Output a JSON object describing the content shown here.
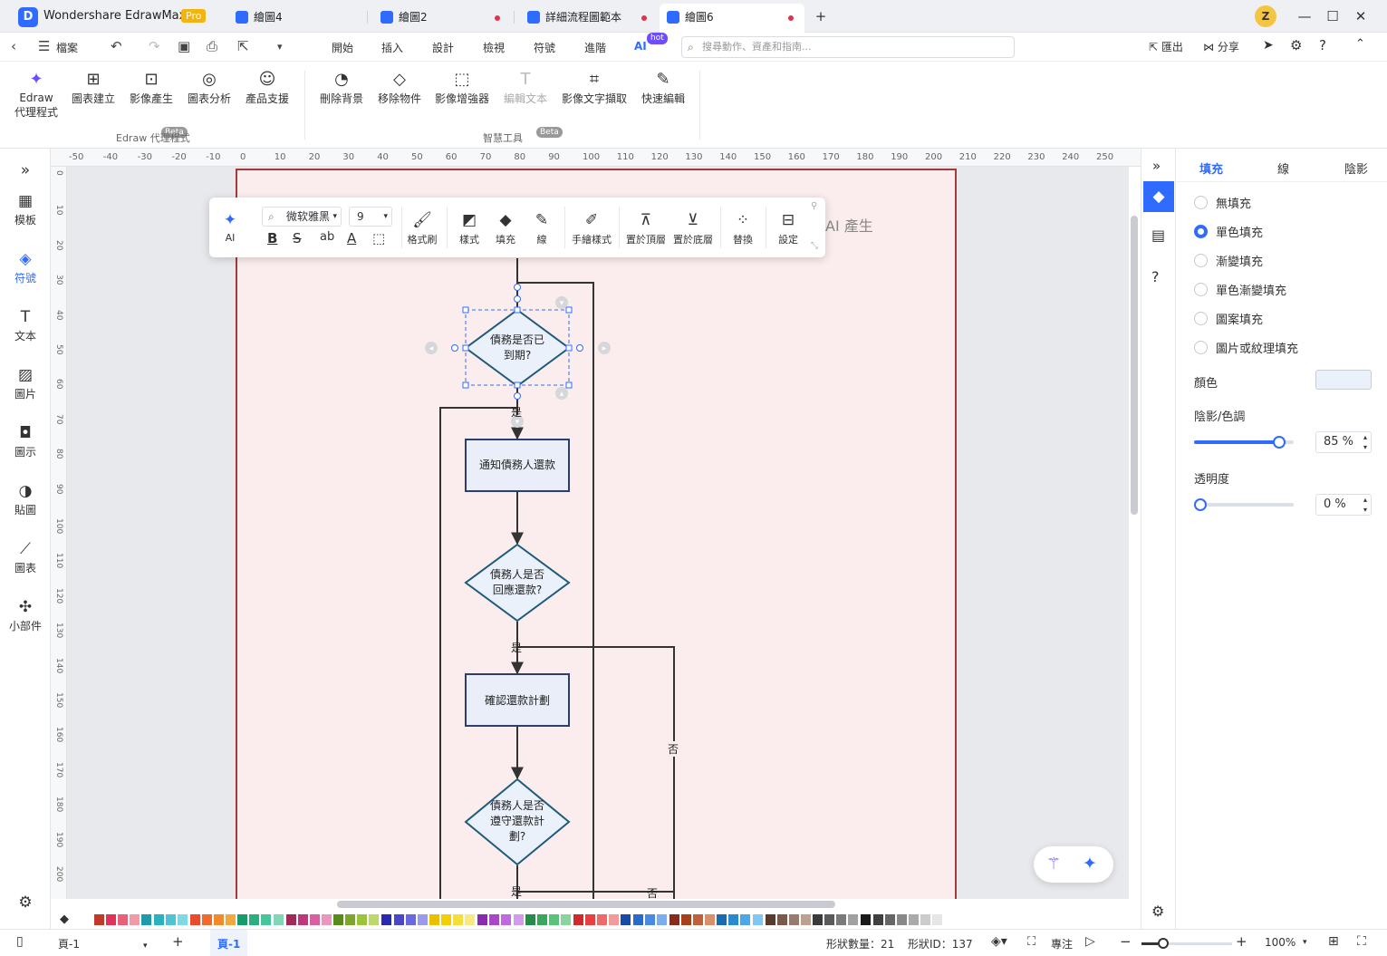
{
  "titlebar": {
    "app_name": "Wondershare EdrawMax",
    "pro_badge": "Pro",
    "tabs": [
      {
        "label": "繪圖4",
        "unsaved": false
      },
      {
        "label": "繪圖2",
        "unsaved": true
      },
      {
        "label": "詳細流程圖範本",
        "unsaved": true
      },
      {
        "label": "繪圖6",
        "unsaved": true,
        "active": true
      }
    ],
    "new_tab": "+",
    "avatar_letter": "Z"
  },
  "menubar": {
    "file_label": "檔案",
    "menus": [
      "開始",
      "插入",
      "設計",
      "檢視",
      "符號",
      "進階",
      "AI"
    ],
    "active_menu": "AI",
    "hot_badge": "hot",
    "search_placeholder": "搜尋動作、資產和指南...",
    "export_label": "匯出",
    "share_label": "分享"
  },
  "ribbon": {
    "agent_group": {
      "label": "Edraw 代理程式",
      "items": [
        {
          "label_line1": "Edraw",
          "label_line2": "代理程式",
          "icon": "sparkle-icon"
        },
        {
          "label": "圖表建立",
          "icon": "chart-build-icon"
        },
        {
          "label": "影像產生",
          "icon": "image-gen-icon",
          "badge": "Beta"
        },
        {
          "label": "圖表分析",
          "icon": "chart-analysis-icon"
        },
        {
          "label": "產品支援",
          "icon": "support-icon"
        }
      ]
    },
    "smart_group": {
      "label": "智慧工具",
      "items": [
        {
          "label": "刪除背景",
          "icon": "remove-bg-icon"
        },
        {
          "label": "移除物件",
          "icon": "eraser-icon"
        },
        {
          "label": "影像增強器",
          "icon": "enhance-icon"
        },
        {
          "label": "編輯文本",
          "icon": "edit-text-icon",
          "badge": "Beta",
          "disabled": true
        },
        {
          "label": "影像文字擷取",
          "icon": "ocr-icon"
        },
        {
          "label": "快速編輯",
          "icon": "quick-edit-icon"
        }
      ]
    }
  },
  "leftbar": {
    "items": [
      {
        "label": "模板",
        "icon": "template-icon"
      },
      {
        "label": "符號",
        "icon": "symbol-icon",
        "active": true
      },
      {
        "label": "文本",
        "icon": "text-icon"
      },
      {
        "label": "圖片",
        "icon": "image-icon"
      },
      {
        "label": "圖示",
        "icon": "icon-icon"
      },
      {
        "label": "貼圖",
        "icon": "sticker-icon"
      },
      {
        "label": "圖表",
        "icon": "chart-icon"
      },
      {
        "label": "小部件",
        "icon": "widget-icon"
      }
    ]
  },
  "ruler": {
    "h_labels": [
      "-50",
      "-40",
      "-30",
      "-20",
      "-10",
      "0",
      "10",
      "20",
      "30",
      "40",
      "50",
      "60",
      "70",
      "80",
      "90",
      "100",
      "110",
      "120",
      "130",
      "140",
      "150",
      "160",
      "170",
      "180",
      "190",
      "200",
      "210",
      "220",
      "230",
      "240",
      "250"
    ],
    "v_labels": [
      "0",
      "10",
      "20",
      "30",
      "40",
      "50",
      "60",
      "70",
      "80",
      "90",
      "100",
      "110",
      "120",
      "130",
      "140",
      "150",
      "160",
      "170",
      "180",
      "190",
      "200"
    ]
  },
  "floating_toolbar": {
    "ai_label": "AI",
    "font_name": "微软雅黑",
    "font_size": "9",
    "format_painter": "格式刷",
    "style": "樣式",
    "fill": "填充",
    "line": "線",
    "hand_drawn": "手繪樣式",
    "bring_front": "置於頂層",
    "send_back": "置於底層",
    "replace": "替換",
    "settings": "設定"
  },
  "canvas": {
    "ai_generated_label": "AI 產生",
    "flowchart": {
      "nodes": [
        {
          "text": "債務是否已\n到期?"
        },
        {
          "text": "通知債務人還款"
        },
        {
          "text": "債務人是否\n回應還款?"
        },
        {
          "text": "確認還款計劃"
        },
        {
          "text": "債務人是否\n遵守還款計\n劃?"
        }
      ],
      "labels": {
        "yes1": "是",
        "yes2": "是",
        "no1": "否",
        "yes3": "是",
        "no2": "否"
      }
    }
  },
  "rightpanel": {
    "tabs": [
      "填充",
      "線",
      "陰影"
    ],
    "active_tab": "填充",
    "fill_options": [
      {
        "label": "無填充",
        "selected": false
      },
      {
        "label": "單色填充",
        "selected": true
      },
      {
        "label": "漸變填充",
        "selected": false
      },
      {
        "label": "單色漸變填充",
        "selected": false
      },
      {
        "label": "圖案填充",
        "selected": false
      },
      {
        "label": "圖片或紋理填充",
        "selected": false
      }
    ],
    "color_label": "顏色",
    "color_value": "#eaf1fb",
    "shade_label": "陰影/色調",
    "shade_value": "85 %",
    "shade_fraction": 0.85,
    "transparency_label": "透明度",
    "transparency_value": "0 %",
    "transparency_fraction": 0
  },
  "palette": {
    "colors": [
      "#c0392b",
      "#e0325a",
      "#e8607a",
      "#f29aa8",
      "#1f9aa8",
      "#2bb0c0",
      "#4cc4d4",
      "#7fd8e4",
      "#e84c2c",
      "#f06a2c",
      "#f08a2c",
      "#f4a83c",
      "#189a6a",
      "#2ab080",
      "#48c49a",
      "#80d6b6",
      "#a02a5c",
      "#c0387c",
      "#d860a0",
      "#e898c0",
      "#5a8a1a",
      "#7aa82a",
      "#9ac43a",
      "#bcd86a",
      "#2a2ab0",
      "#4848c8",
      "#6a6ae0",
      "#9a9aee",
      "#e8c000",
      "#f0d000",
      "#f4de3c",
      "#f8ea80",
      "#8a2ab0",
      "#a848c8",
      "#c06ae0",
      "#d49aee",
      "#2a8a4a",
      "#3aa85a",
      "#5ac07a",
      "#8ad4a2",
      "#d02a2a",
      "#e84040",
      "#f06a6a",
      "#f49a9a",
      "#1a4aa8",
      "#2a6ac8",
      "#4a8ae0",
      "#7aaef0",
      "#8a2a1a",
      "#a8401a",
      "#c0603a",
      "#d8906a",
      "#1a6ab0",
      "#2a8ad0",
      "#4aa8e8",
      "#80c8f4",
      "#5a3a2a",
      "#7a5a4a",
      "#9a7a6a",
      "#bca090",
      "#3a3a3a",
      "#5a5a5a",
      "#7a7a7a",
      "#a0a0a0",
      "#1a1a1a",
      "#404040",
      "#666666",
      "#888888",
      "#aaaaaa",
      "#cccccc",
      "#e6e6e6"
    ]
  },
  "statusbar": {
    "page_select": "頁-1",
    "page_tab": "頁-1",
    "shape_count": "形狀數量：21",
    "shape_id": "形狀ID：137",
    "focus": "專注",
    "zoom": "100%"
  }
}
